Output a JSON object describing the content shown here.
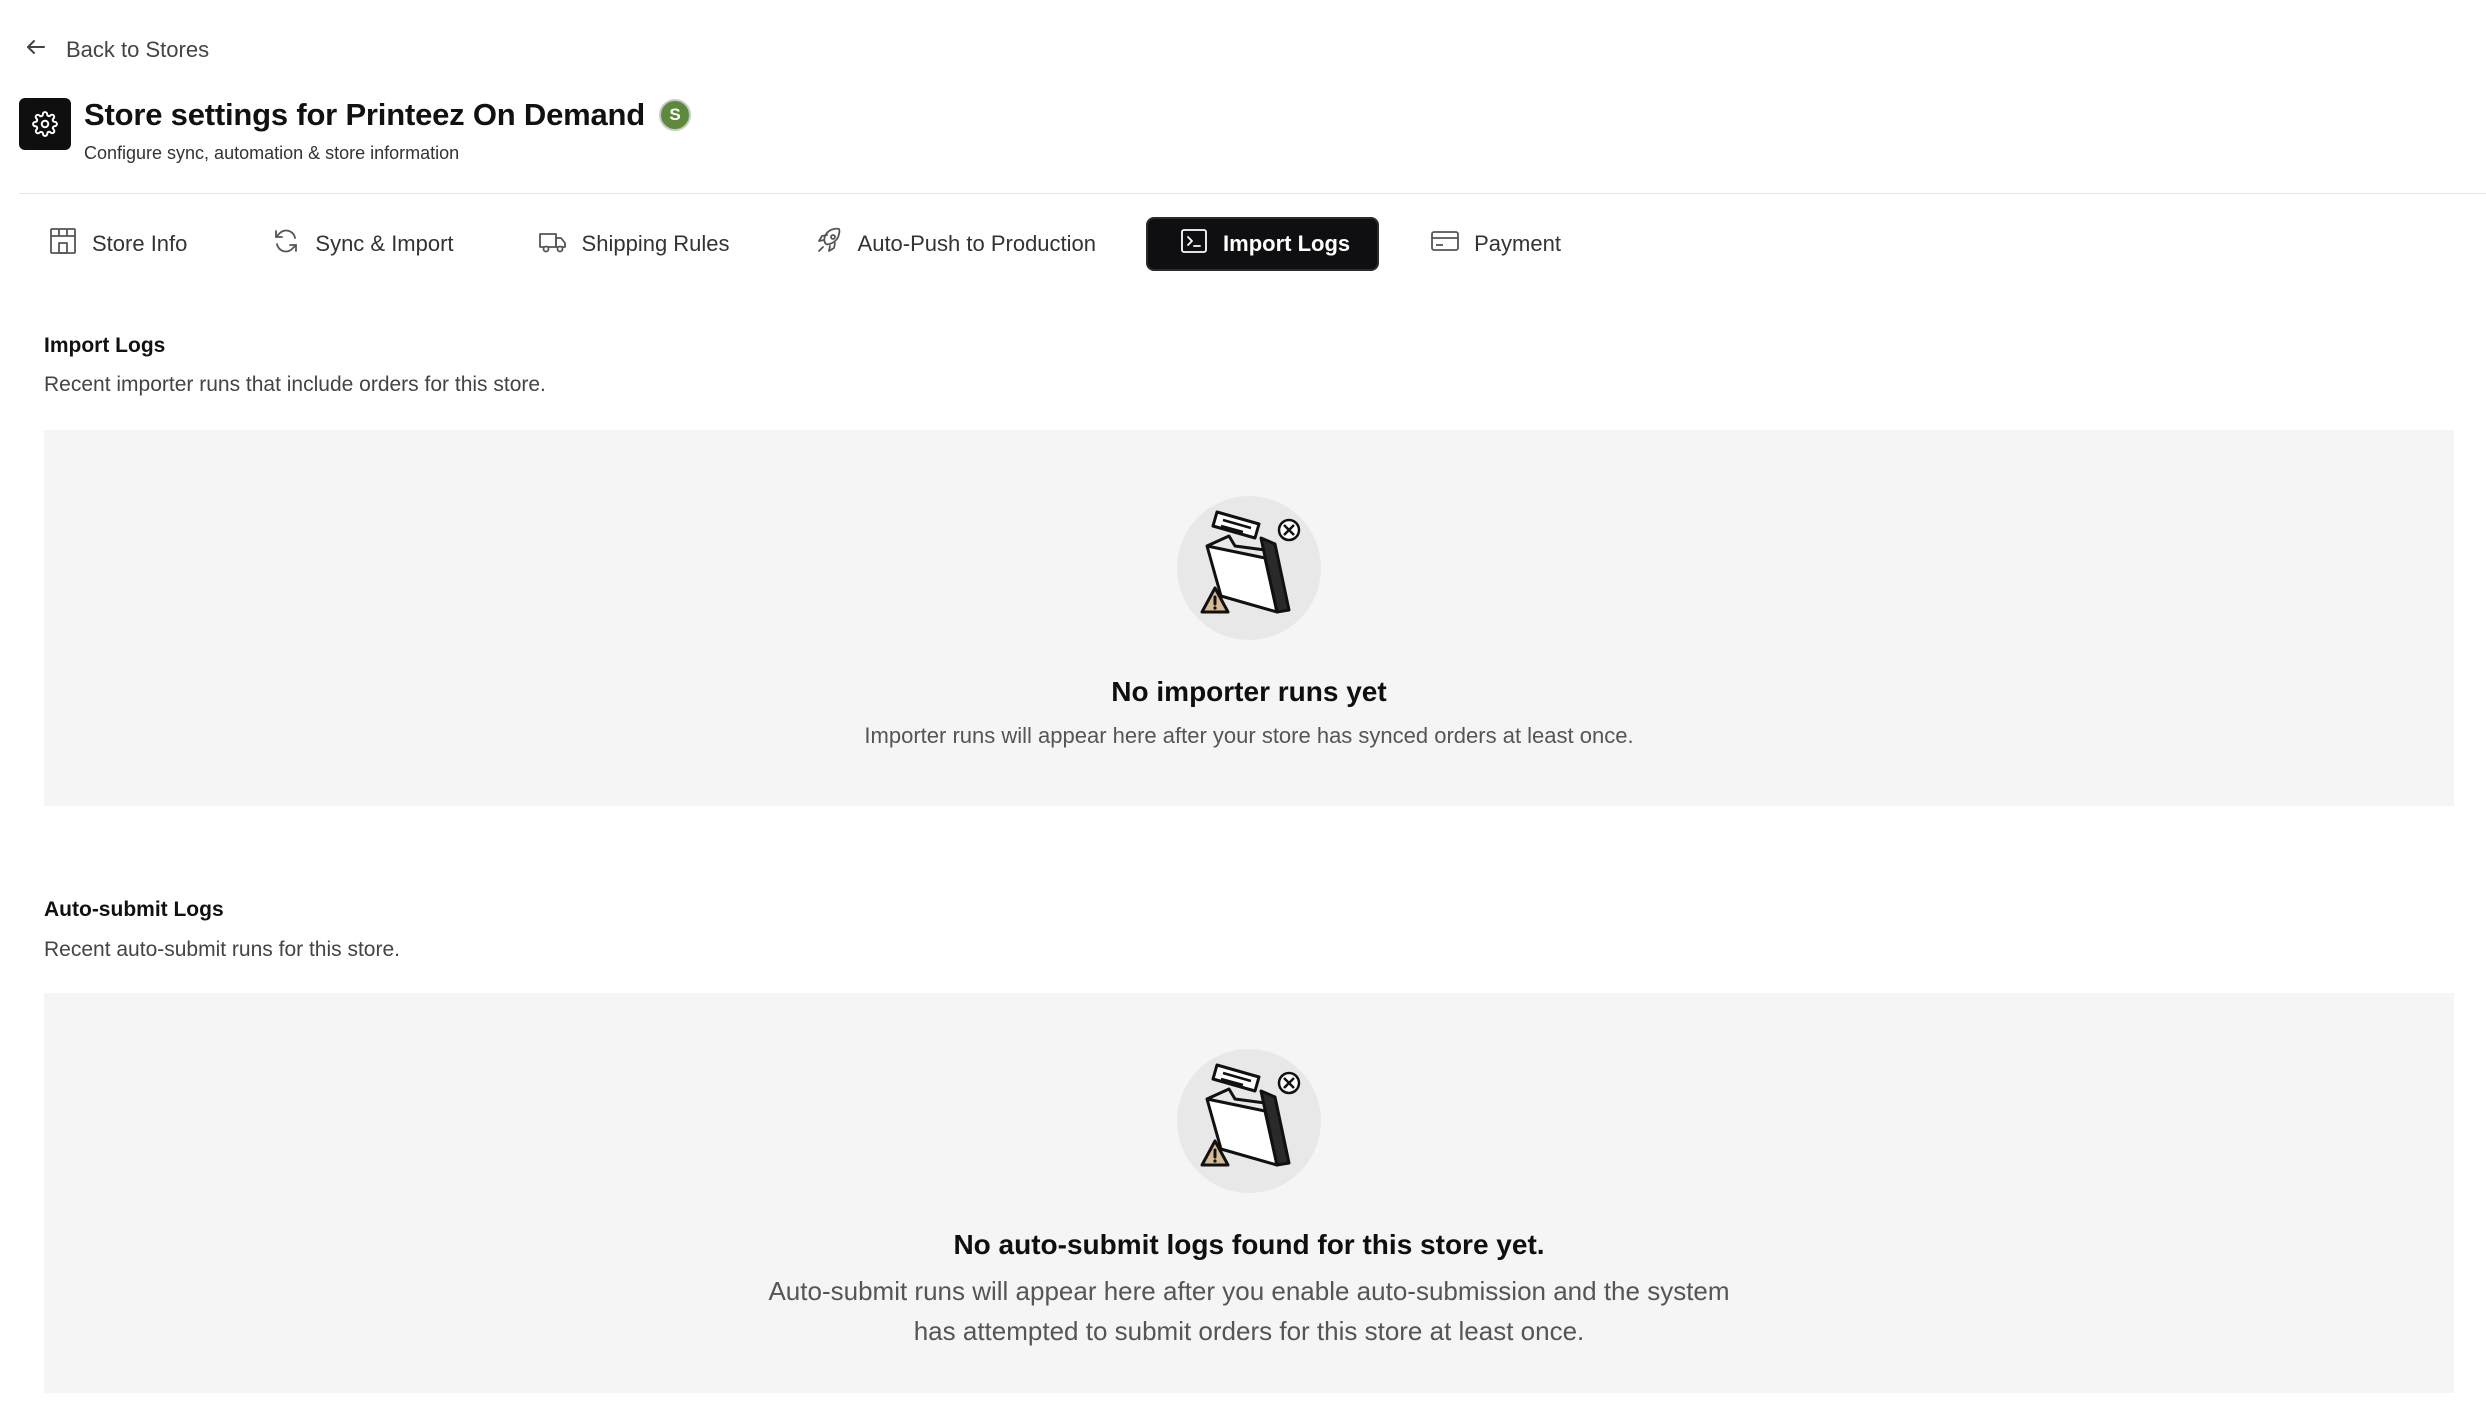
{
  "back_link": {
    "label": "Back to Stores",
    "icon": "arrow-left-icon"
  },
  "header": {
    "icon": "gear-icon",
    "title": "Store settings for Printeez On Demand",
    "badge_letter": "S",
    "badge_icon": "shopify-icon",
    "subtitle": "Configure sync, automation & store information"
  },
  "tabs": [
    {
      "label": "Store Info",
      "icon": "store-icon",
      "active": false
    },
    {
      "label": "Sync & Import",
      "icon": "refresh-icon",
      "active": false
    },
    {
      "label": "Shipping Rules",
      "icon": "truck-icon",
      "active": false
    },
    {
      "label": "Auto-Push to Production",
      "icon": "rocket-icon",
      "active": false
    },
    {
      "label": "Import Logs",
      "icon": "terminal-icon",
      "active": true
    },
    {
      "label": "Payment",
      "icon": "credit-card-icon",
      "active": false
    }
  ],
  "import_logs": {
    "title": "Import Logs",
    "description": "Recent importer runs that include orders for this store.",
    "empty_title": "No importer runs yet",
    "empty_description": "Importer runs will appear here after your store has synced orders at least once."
  },
  "auto_submit_logs": {
    "title": "Auto-submit Logs",
    "description": "Recent auto-submit runs for this store.",
    "empty_title": "No auto-submit logs found for this store yet.",
    "empty_description_line1": "Auto-submit runs will appear here after you enable auto-submission and the system",
    "empty_description_line2": "has attempted to submit orders for this store at least once."
  },
  "colors": {
    "active_tab_bg": "#0f0f12",
    "panel_bg": "#f5f5f5",
    "shopify_green": "#5c8a3a",
    "warning_tan": "#d6bc94"
  }
}
